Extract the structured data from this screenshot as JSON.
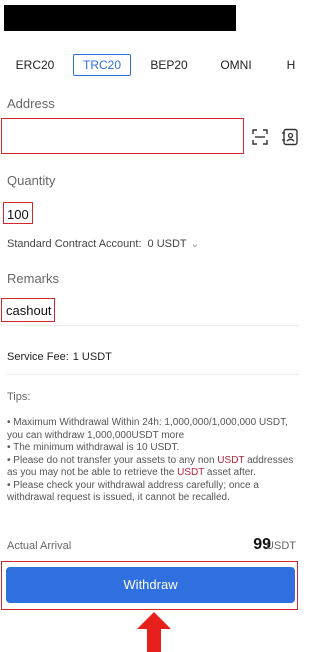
{
  "header": {
    "back_icon": "back-arrow-icon"
  },
  "network_tabs": [
    "ERC20",
    "TRC20",
    "BEP20",
    "OMNI",
    "H"
  ],
  "active_tab": "TRC20",
  "address": {
    "label": "Address",
    "scan_icon": "scan-icon",
    "address_book_icon": "address-book-icon"
  },
  "quantity": {
    "label": "Quantity",
    "value": "100"
  },
  "account": {
    "label": "Standard Contract Account:",
    "value": "0 USDT",
    "chevron_icon": "chevron-down-icon"
  },
  "remarks": {
    "label": "Remarks",
    "value": "cashout"
  },
  "fee": {
    "label": "Service Fee:",
    "value": "1 USDT"
  },
  "tips": {
    "title": "Tips:",
    "line1": "• Maximum Withdrawal Within 24h: 1,000,000/1,000,000 USDT, you can withdraw 1,000,000USDT more",
    "line2": "• The minimum withdrawal is 10 USDT.",
    "line3_a": "• Please do not transfer your assets to any non ",
    "line3_red1": "USDT",
    "line3_b": " addresses as you may not be able to retrieve the ",
    "line3_red2": "USDT",
    "line3_c": " asset after.",
    "line4": "• Please check your withdrawal address carefully; once a withdrawal request is issued, it cannot be recalled."
  },
  "arrival": {
    "label": "Actual Arrival",
    "amount": "99",
    "unit": "USDT"
  },
  "withdraw_button": "Withdraw",
  "colors": {
    "primary": "#2f6fe0",
    "highlight": "#d4252f",
    "warning_text": "#b3263a"
  }
}
